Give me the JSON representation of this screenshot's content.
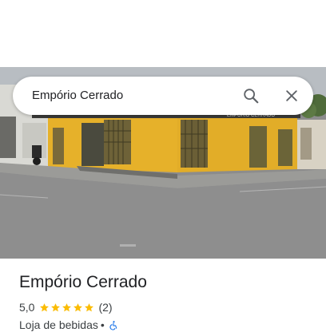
{
  "search": {
    "query": "Empório Cerrado"
  },
  "photo": {
    "storefront_sign": "EMPÓRIO CERRADO"
  },
  "place": {
    "title": "Empório Cerrado",
    "rating": "5,0",
    "stars": 5,
    "review_count": "(2)",
    "category": "Loja de bebidas",
    "separator": "•"
  },
  "icons": {
    "search": "search-icon",
    "close": "close-icon",
    "star": "star-icon",
    "accessibility": "wheelchair-accessible-icon"
  },
  "colors": {
    "star": "#fbbc04",
    "accessibility": "#1a73e8",
    "wall_yellow": "#e8b32c"
  }
}
